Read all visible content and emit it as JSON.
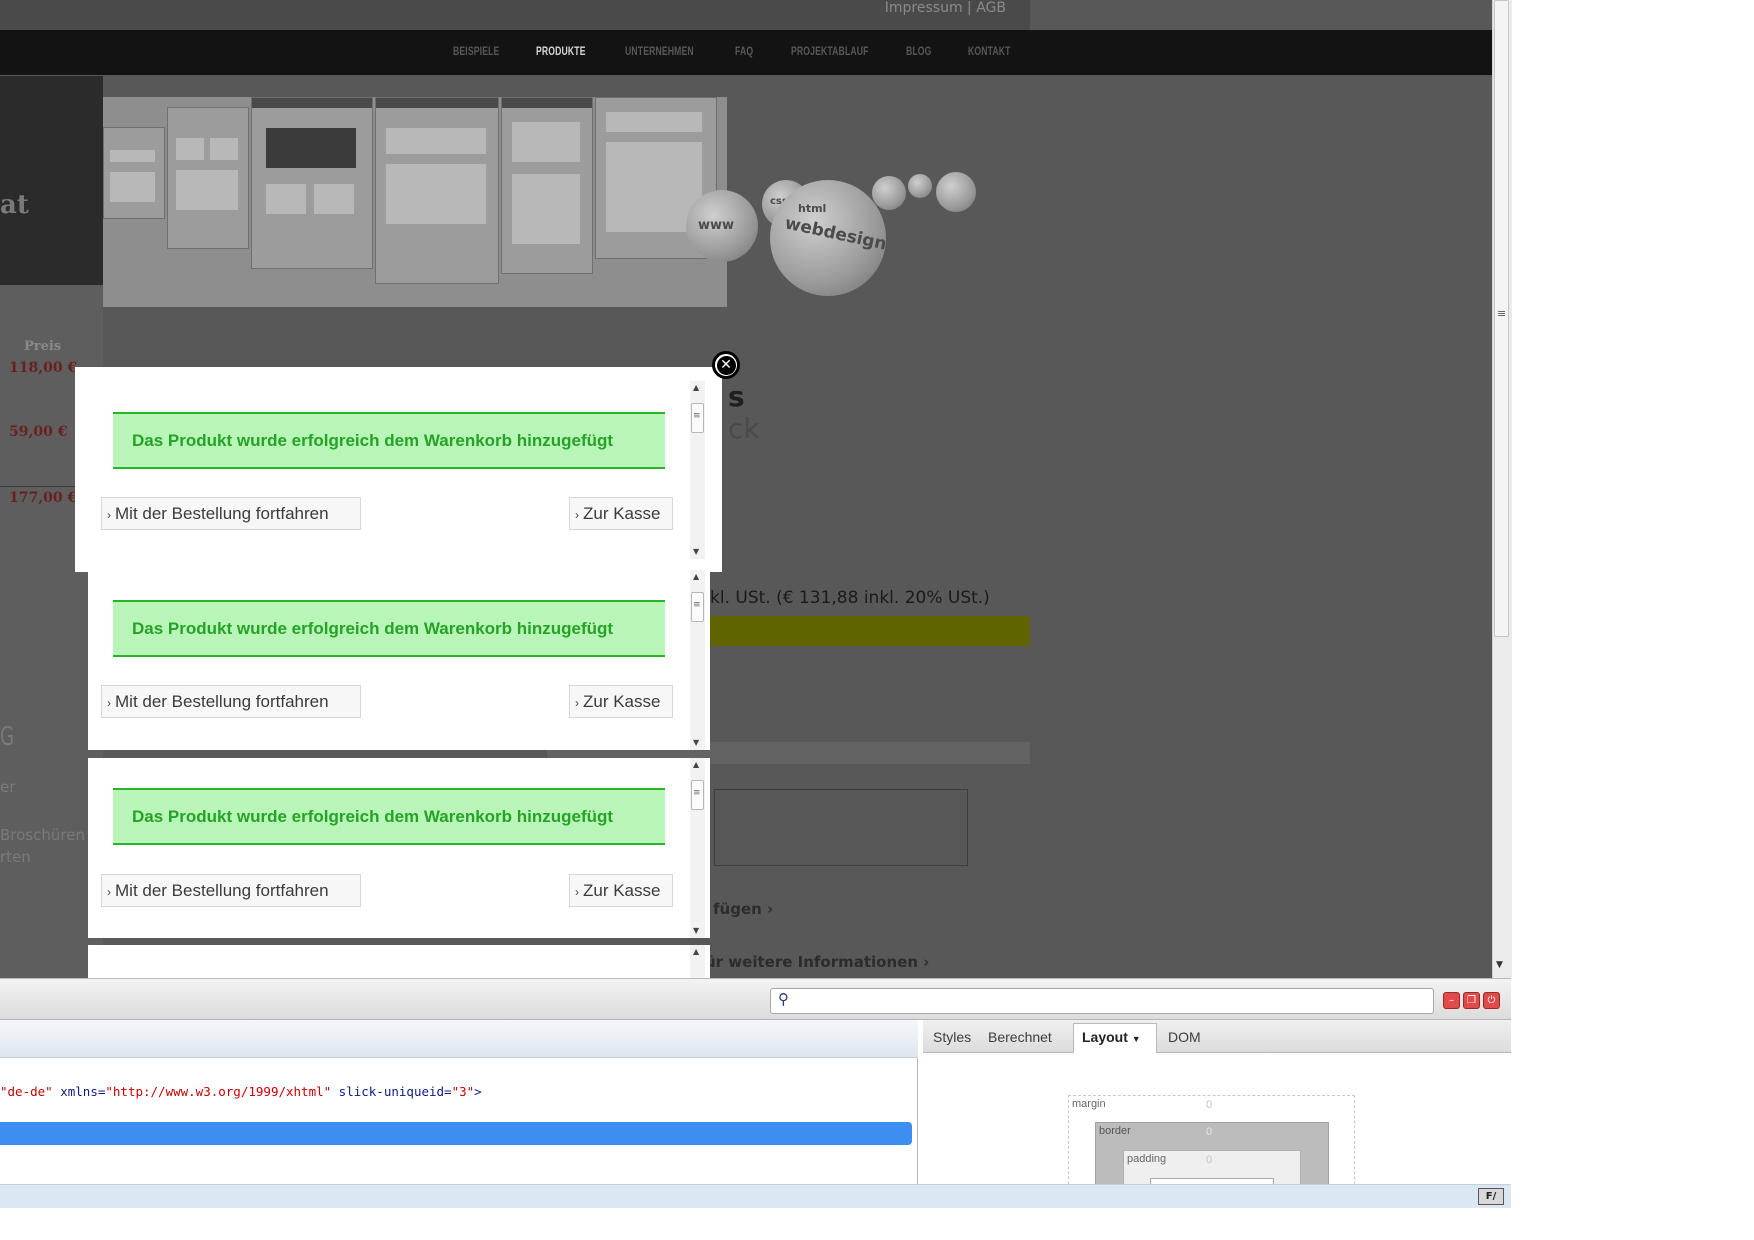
{
  "website": {
    "top_links": "Impressum | AGB",
    "nav": [
      "BEISPIELE",
      "PRODUKTE",
      "UNTERNEHMEN",
      "FAQ",
      "PROJEKTABLAUF",
      "BLOG",
      "KONTAKT"
    ],
    "active_nav": "PRODUKTE",
    "teaser_fragment": "at",
    "price_label": "Preis",
    "prices": [
      "118,00 €",
      "59,00 €",
      "177,00 €"
    ],
    "left_heading_fragment": "G",
    "left_texts": [
      "er",
      "Broschüren",
      "rten"
    ],
    "title_fragment_1": "s",
    "title_fragment_2": "ck",
    "vat_text": "kl. USt. (€ 131,88 inkl. 20% USt.)",
    "link_fragment_1": "fügen ›",
    "link_fragment_2": "ür weitere Informationen ›",
    "banner_sphere_words": [
      "www",
      "webdesign",
      "html",
      "css"
    ]
  },
  "dialogs": [
    {
      "message": "Das Produkt wurde erfolgreich dem Warenkorb hinzugefügt",
      "continue_label": "Mit der Bestellung fortfahren",
      "checkout_label": "Zur Kasse"
    },
    {
      "message": "Das Produkt wurde erfolgreich dem Warenkorb hinzugefügt",
      "continue_label": "Mit der Bestellung fortfahren",
      "checkout_label": "Zur Kasse"
    },
    {
      "message": "Das Produkt wurde erfolgreich dem Warenkorb hinzugefügt",
      "continue_label": "Mit der Bestellung fortfahren",
      "checkout_label": "Zur Kasse"
    }
  ],
  "devtools": {
    "search_value": "",
    "code_line": {
      "lang_value": "\"de-de\"",
      "xmlns_attr": " xmlns=",
      "xmlns_value": "\"http://www.w3.org/1999/xhtml\"",
      "slick_attr": " slick-uniqueid=",
      "slick_value": "\"3\"",
      "close": ">"
    },
    "side_tabs": [
      "Styles",
      "Berechnet",
      "Layout",
      "DOM"
    ],
    "active_side_tab": "Layout",
    "box_model": {
      "margin_label": "margin",
      "border_label": "border",
      "padding_label": "padding",
      "margin_value": "0",
      "border_value": "0",
      "padding_value": "0"
    },
    "status_icon": "F/"
  },
  "colors": {
    "success_bg": "#b9f5b9",
    "success_text": "#25a325",
    "selection": "#3c8ef0"
  },
  "icons": {
    "close": "close-circle-icon",
    "search": "search-icon",
    "chevron": "chevron-right-icon"
  }
}
